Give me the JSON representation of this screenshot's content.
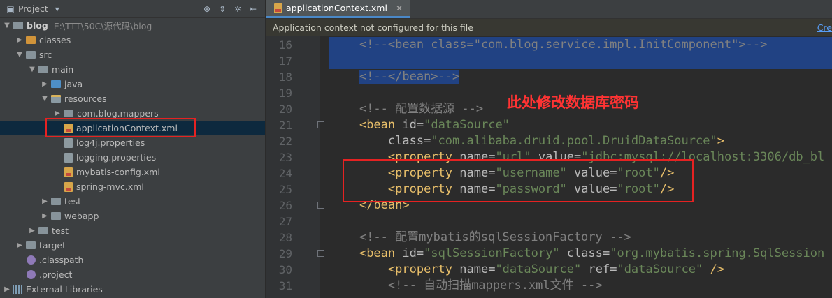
{
  "project_panel": {
    "title": "Project",
    "tree": [
      {
        "indent": 0,
        "arrow": "▼",
        "icon": "folder",
        "label": "blog",
        "path": "E:\\TTT\\50C\\源代码\\blog",
        "bold": true
      },
      {
        "indent": 1,
        "arrow": "▶",
        "icon": "folder-orange",
        "label": "classes"
      },
      {
        "indent": 1,
        "arrow": "▼",
        "icon": "folder",
        "label": "src"
      },
      {
        "indent": 2,
        "arrow": "▼",
        "icon": "folder",
        "label": "main"
      },
      {
        "indent": 3,
        "arrow": "▶",
        "icon": "folder-blue",
        "label": "java"
      },
      {
        "indent": 3,
        "arrow": "▼",
        "icon": "folder-res",
        "label": "resources"
      },
      {
        "indent": 4,
        "arrow": "▶",
        "icon": "folder",
        "label": "com.blog.mappers"
      },
      {
        "indent": 4,
        "arrow": "",
        "icon": "xml",
        "label": "applicationContext.xml",
        "selected": true
      },
      {
        "indent": 4,
        "arrow": "",
        "icon": "prop",
        "label": "log4j.properties"
      },
      {
        "indent": 4,
        "arrow": "",
        "icon": "prop",
        "label": "logging.properties"
      },
      {
        "indent": 4,
        "arrow": "",
        "icon": "xml",
        "label": "mybatis-config.xml"
      },
      {
        "indent": 4,
        "arrow": "",
        "icon": "xml",
        "label": "spring-mvc.xml"
      },
      {
        "indent": 3,
        "arrow": "▶",
        "icon": "folder",
        "label": "test"
      },
      {
        "indent": 3,
        "arrow": "▶",
        "icon": "folder",
        "label": "webapp"
      },
      {
        "indent": 2,
        "arrow": "▶",
        "icon": "folder",
        "label": "test"
      },
      {
        "indent": 1,
        "arrow": "▶",
        "icon": "folder",
        "label": "target"
      },
      {
        "indent": 1,
        "arrow": "",
        "icon": "dot",
        "label": ".classpath"
      },
      {
        "indent": 1,
        "arrow": "",
        "icon": "dot",
        "label": ".project"
      },
      {
        "indent": 0,
        "arrow": "▶",
        "icon": "lib",
        "label": "External Libraries"
      }
    ]
  },
  "editor": {
    "tab_label": "applicationContext.xml",
    "notice": "Application context not configured for this file",
    "notice_link": "Cre",
    "annotation": "此处修改数据库密码",
    "lines": [
      {
        "n": "16",
        "sel": true,
        "segs": [
          [
            "    ",
            ""
          ],
          [
            "<!--<bean class=\"com.blog.service.impl.InitComponent\">-->",
            "c"
          ]
        ]
      },
      {
        "n": "17",
        "sel": true,
        "segs": [
          [
            "",
            ""
          ]
        ]
      },
      {
        "n": "18",
        "sel": "part",
        "segs": [
          [
            "    ",
            ""
          ],
          [
            "<!--</bean>-->",
            "c"
          ]
        ]
      },
      {
        "n": "19",
        "segs": [
          [
            "",
            ""
          ]
        ]
      },
      {
        "n": "20",
        "segs": [
          [
            "    ",
            ""
          ],
          [
            "<!-- 配置数据源 -->",
            "c"
          ]
        ]
      },
      {
        "n": "21",
        "fold": true,
        "segs": [
          [
            "    ",
            ""
          ],
          [
            "<bean ",
            "t"
          ],
          [
            "id=",
            "a"
          ],
          [
            "\"dataSource\"",
            "v"
          ]
        ]
      },
      {
        "n": "22",
        "segs": [
          [
            "        ",
            ""
          ],
          [
            "class=",
            "a"
          ],
          [
            "\"com.alibaba.druid.pool.DruidDataSource\"",
            "v"
          ],
          [
            ">",
            "t"
          ]
        ]
      },
      {
        "n": "23",
        "segs": [
          [
            "        ",
            ""
          ],
          [
            "<property ",
            "t"
          ],
          [
            "name=",
            "a"
          ],
          [
            "\"url\" ",
            "v"
          ],
          [
            "value=",
            "a"
          ],
          [
            "\"jdbc:mysql://localhost:3306/db_bl",
            "v"
          ]
        ]
      },
      {
        "n": "24",
        "segs": [
          [
            "        ",
            ""
          ],
          [
            "<property ",
            "t"
          ],
          [
            "name=",
            "a"
          ],
          [
            "\"username\" ",
            "v"
          ],
          [
            "value=",
            "a"
          ],
          [
            "\"root\"",
            "v"
          ],
          [
            "/>",
            "t"
          ]
        ]
      },
      {
        "n": "25",
        "segs": [
          [
            "        ",
            ""
          ],
          [
            "<property ",
            "t"
          ],
          [
            "name=",
            "a"
          ],
          [
            "\"password\" ",
            "v"
          ],
          [
            "value=",
            "a"
          ],
          [
            "\"root\"",
            "v"
          ],
          [
            "/>",
            "t"
          ]
        ]
      },
      {
        "n": "26",
        "fold": true,
        "segs": [
          [
            "    ",
            ""
          ],
          [
            "</bean>",
            "t"
          ]
        ]
      },
      {
        "n": "27",
        "segs": [
          [
            "",
            ""
          ]
        ]
      },
      {
        "n": "28",
        "segs": [
          [
            "    ",
            ""
          ],
          [
            "<!-- 配置mybatis的sqlSessionFactory -->",
            "c"
          ]
        ]
      },
      {
        "n": "29",
        "fold": true,
        "segs": [
          [
            "    ",
            ""
          ],
          [
            "<bean ",
            "t"
          ],
          [
            "id=",
            "a"
          ],
          [
            "\"sqlSessionFactory\" ",
            "v"
          ],
          [
            "class=",
            "a"
          ],
          [
            "\"org.mybatis.spring.SqlSession",
            "v"
          ]
        ]
      },
      {
        "n": "30",
        "segs": [
          [
            "        ",
            ""
          ],
          [
            "<property ",
            "t"
          ],
          [
            "name=",
            "a"
          ],
          [
            "\"dataSource\" ",
            "v"
          ],
          [
            "ref=",
            "a"
          ],
          [
            "\"dataSource\" ",
            "v"
          ],
          [
            "/>",
            "t"
          ]
        ]
      },
      {
        "n": "31",
        "segs": [
          [
            "        ",
            ""
          ],
          [
            "<!-- 自动扫描mappers.xml文件 -->",
            "c"
          ]
        ]
      }
    ]
  }
}
